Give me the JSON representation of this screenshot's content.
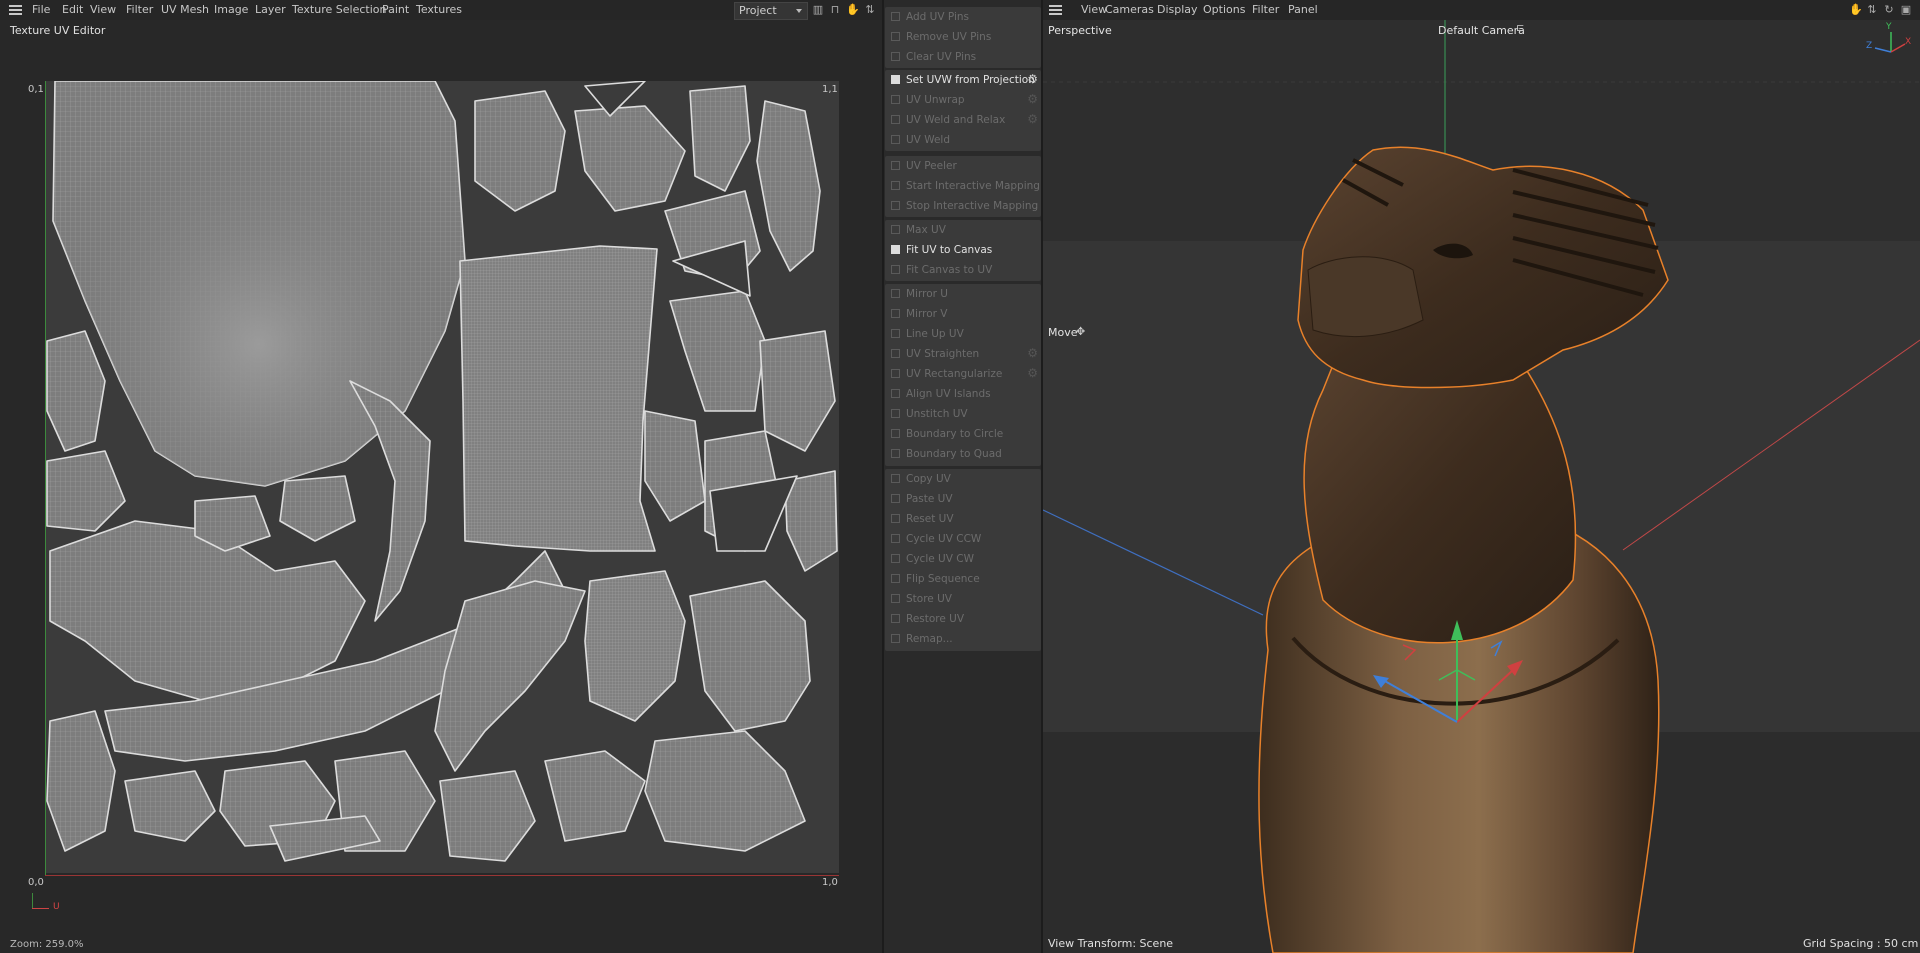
{
  "uv_editor": {
    "menu": [
      "File",
      "Edit",
      "View",
      "Filter",
      "UV Mesh",
      "Image",
      "Layer",
      "Texture Selection",
      "Paint",
      "Textures"
    ],
    "project_select": "Project",
    "title": "Texture UV Editor",
    "corner_top_left": "0,1",
    "corner_top_right": "1,1",
    "corner_bottom_left": "0,0",
    "corner_bottom_right": "1,0",
    "axis_label_u": "U",
    "zoom_text": "Zoom: 259.0%"
  },
  "commands": [
    {
      "label": "Add UV Pins",
      "enabled": false,
      "gear": false
    },
    {
      "label": "Remove UV Pins",
      "enabled": false,
      "gear": false
    },
    {
      "label": "Clear UV Pins",
      "enabled": false,
      "gear": false
    },
    {
      "label": "Set UVW from Projection",
      "enabled": true,
      "gear": true
    },
    {
      "label": "UV Unwrap",
      "enabled": false,
      "gear": true
    },
    {
      "label": "UV Weld and Relax",
      "enabled": false,
      "gear": true
    },
    {
      "label": "UV Weld",
      "enabled": false,
      "gear": false
    },
    {
      "label": "UV Peeler",
      "enabled": false,
      "gear": false
    },
    {
      "label": "Start Interactive Mapping",
      "enabled": false,
      "gear": false
    },
    {
      "label": "Stop Interactive Mapping",
      "enabled": false,
      "gear": false
    },
    {
      "label": "Max UV",
      "enabled": false,
      "gear": false
    },
    {
      "label": "Fit UV to Canvas",
      "enabled": true,
      "gear": false
    },
    {
      "label": "Fit Canvas to UV",
      "enabled": false,
      "gear": false
    },
    {
      "label": "Mirror U",
      "enabled": false,
      "gear": false
    },
    {
      "label": "Mirror V",
      "enabled": false,
      "gear": false
    },
    {
      "label": "Line Up UV",
      "enabled": false,
      "gear": false
    },
    {
      "label": "UV Straighten",
      "enabled": false,
      "gear": true
    },
    {
      "label": "UV Rectangularize",
      "enabled": false,
      "gear": true
    },
    {
      "label": "Align UV Islands",
      "enabled": false,
      "gear": false
    },
    {
      "label": "Unstitch UV",
      "enabled": false,
      "gear": false
    },
    {
      "label": "Boundary to Circle",
      "enabled": false,
      "gear": false
    },
    {
      "label": "Boundary to Quad",
      "enabled": false,
      "gear": false
    },
    {
      "label": "Copy UV",
      "enabled": false,
      "gear": false
    },
    {
      "label": "Paste UV",
      "enabled": false,
      "gear": false
    },
    {
      "label": "Reset UV",
      "enabled": false,
      "gear": false
    },
    {
      "label": "Cycle UV CCW",
      "enabled": false,
      "gear": false
    },
    {
      "label": "Cycle UV CW",
      "enabled": false,
      "gear": false
    },
    {
      "label": "Flip Sequence",
      "enabled": false,
      "gear": false
    },
    {
      "label": "Store UV",
      "enabled": false,
      "gear": false
    },
    {
      "label": "Restore UV",
      "enabled": false,
      "gear": false
    },
    {
      "label": "Remap...",
      "enabled": false,
      "gear": false
    }
  ],
  "viewport": {
    "menu": [
      "View",
      "Cameras",
      "Display",
      "Options",
      "Filter",
      "Panel"
    ],
    "projection": "Perspective",
    "camera": "Default Camera",
    "tool": "Move",
    "view_transform": "View Transform: Scene",
    "grid_spacing": "Grid Spacing : 50 cm",
    "axis_x": "X",
    "axis_y": "Y",
    "axis_z": "Z"
  },
  "colors": {
    "accent_selection": "#e8812a",
    "axis_x": "#d04040",
    "axis_y": "#3fbf5a",
    "axis_z": "#3f7fd8",
    "wood_dark": "#3a2a1c",
    "wood_light": "#8a6a48"
  }
}
